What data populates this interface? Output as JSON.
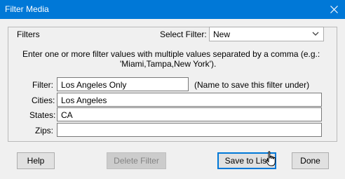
{
  "window": {
    "title": "Filter Media"
  },
  "group": {
    "label": "Filters",
    "select_filter_label": "Select Filter:",
    "select_filter_value": "New",
    "instructions_line1": "Enter one or more filter values with multiple values separated by a comma (e.g.:",
    "instructions_line2": "'Miami,Tampa,New York')."
  },
  "form": {
    "filter_label": "Filter:",
    "filter_value": "Los Angeles Only",
    "filter_hint": "(Name to save this filter under)",
    "cities_label": "Cities:",
    "cities_value": "Los Angeles",
    "states_label": "States:",
    "states_value": "CA",
    "zips_label": "Zips:",
    "zips_value": ""
  },
  "buttons": {
    "help": "Help",
    "delete_filter": "Delete Filter",
    "save_to_list": "Save to List",
    "done": "Done"
  },
  "colors": {
    "titlebar": "#0078d7",
    "default_button_border": "#0078d7"
  },
  "icons": {
    "close": "close-icon",
    "dropdown": "chevron-down-icon",
    "cursor": "hand-pointer-icon"
  }
}
